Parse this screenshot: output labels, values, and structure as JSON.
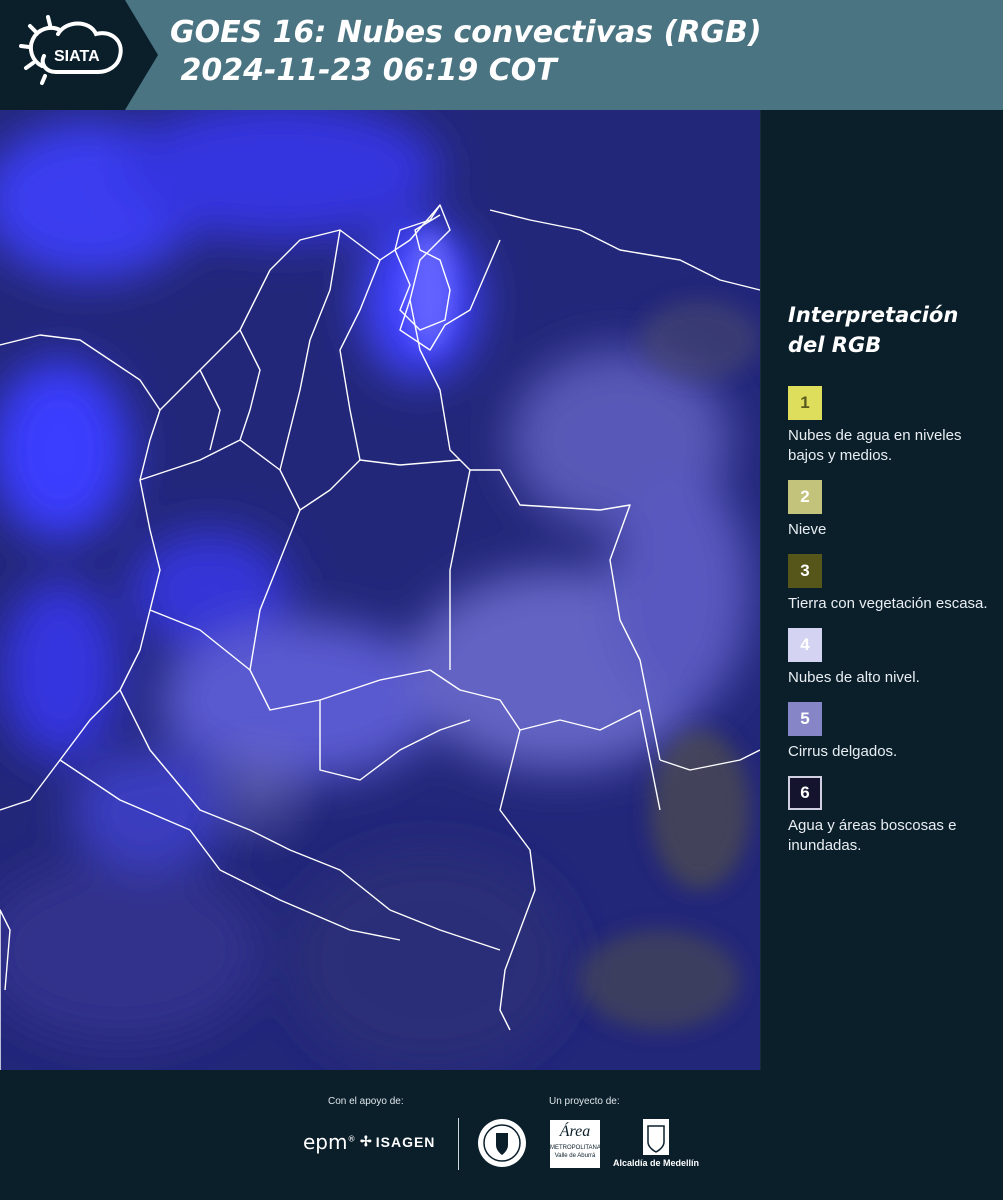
{
  "header": {
    "logo_text": "SIATA",
    "title_line1": "GOES 16: Nubes convectivas (RGB)",
    "title_line2": " 2024-11-23 06:19 COT"
  },
  "colors": {
    "header_bg": "#4a7482",
    "page_bg": "#0b1f2b",
    "map_base": "#23277a",
    "cloud_blue": "#3d3dff",
    "border_lines": "#ffffff"
  },
  "legend": {
    "title": "Interpretación del RGB",
    "items": [
      {
        "num": "1",
        "label": "Nubes de agua en niveles bajos y medios.",
        "color": "#dede5c",
        "text_color": "#5a5a20"
      },
      {
        "num": "2",
        "label": "Nieve",
        "color": "#c3c37c",
        "text_color": "#ffffff"
      },
      {
        "num": "3",
        "label": "Tierra con vegetación escasa.",
        "color": "#56561a",
        "text_color": "#ffffff"
      },
      {
        "num": "4",
        "label": "Nubes de alto nivel.",
        "color": "#d4d4f2",
        "text_color": "#ffffff"
      },
      {
        "num": "5",
        "label": "Cirrus delgados.",
        "color": "#8585c8",
        "text_color": "#ffffff"
      },
      {
        "num": "6",
        "label": "Agua y áreas boscosas e inundadas.",
        "color": "#14142e",
        "text_color": "#ffffff"
      }
    ]
  },
  "footer": {
    "support_label": "Con el apoyo de:",
    "project_label": "Un proyecto de:",
    "sponsor1": "epm",
    "sponsor2": "ISAGEN",
    "partner1_line1": "Área",
    "partner1_line2": "METROPOLITANA",
    "partner1_line3": "Valle de Aburrá",
    "partner2": "Alcaldía de Medellín"
  }
}
